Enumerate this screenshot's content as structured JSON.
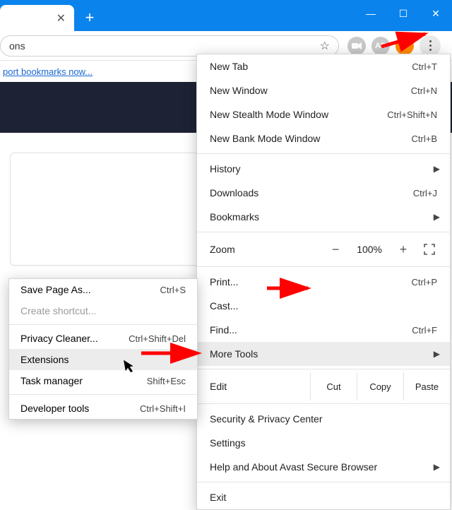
{
  "window": {
    "minimize": "—",
    "maximize": "☐",
    "close": "✕"
  },
  "tab": {
    "close": "✕",
    "newtab": "+"
  },
  "omnibox": {
    "text": "ons",
    "star_icon": "star"
  },
  "ext": {
    "cam": "■",
    "ad": "AD",
    "avast": "◆",
    "dots": "⋮"
  },
  "bookmarks_hint": "port bookmarks now...",
  "menu": {
    "new_tab": "New Tab",
    "new_tab_k": "Ctrl+T",
    "new_window": "New Window",
    "new_window_k": "Ctrl+N",
    "stealth": "New Stealth Mode Window",
    "stealth_k": "Ctrl+Shift+N",
    "bank": "New Bank Mode Window",
    "bank_k": "Ctrl+B",
    "history": "History",
    "downloads": "Downloads",
    "downloads_k": "Ctrl+J",
    "bookmarks": "Bookmarks",
    "zoom": "Zoom",
    "zoom_minus": "−",
    "zoom_val": "100%",
    "zoom_plus": "+",
    "print": "Print...",
    "print_k": "Ctrl+P",
    "cast": "Cast...",
    "find": "Find...",
    "find_k": "Ctrl+F",
    "more_tools": "More Tools",
    "edit": "Edit",
    "cut": "Cut",
    "copy": "Copy",
    "paste": "Paste",
    "security": "Security & Privacy Center",
    "settings": "Settings",
    "help": "Help and About Avast Secure Browser",
    "exit": "Exit"
  },
  "submenu": {
    "save_as": "Save Page As...",
    "save_as_k": "Ctrl+S",
    "create_shortcut": "Create shortcut...",
    "privacy": "Privacy Cleaner...",
    "privacy_k": "Ctrl+Shift+Del",
    "extensions": "Extensions",
    "task": "Task manager",
    "task_k": "Shift+Esc",
    "dev": "Developer tools",
    "dev_k": "Ctrl+Shift+I"
  }
}
